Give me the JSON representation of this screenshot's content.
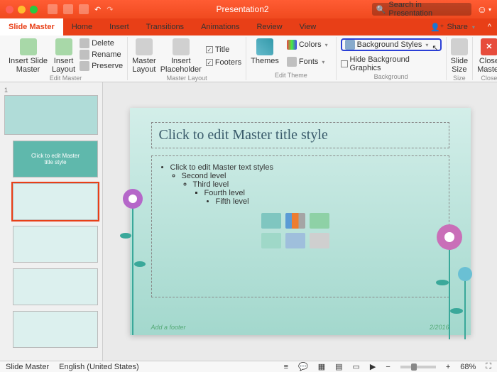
{
  "title": "Presentation2",
  "search_placeholder": "Search in Presentation",
  "share": "Share",
  "tabs": [
    "Slide Master",
    "Home",
    "Insert",
    "Transitions",
    "Animations",
    "Review",
    "View"
  ],
  "ribbon": {
    "insert_slide_master": "Insert Slide\nMaster",
    "insert_layout": "Insert\nLayout",
    "delete": "Delete",
    "rename": "Rename",
    "preserve": "Preserve",
    "edit_master": "Edit Master",
    "master_layout": "Master\nLayout",
    "insert_placeholder": "Insert\nPlaceholder",
    "title_chk": "Title",
    "footers_chk": "Footers",
    "master_layout_group": "Master Layout",
    "themes": "Themes",
    "colors": "Colors",
    "fonts": "Fonts",
    "edit_theme": "Edit Theme",
    "background_styles": "Background Styles",
    "hide_bg": "Hide Background Graphics",
    "background": "Background",
    "slide_size": "Slide\nSize",
    "size": "Size",
    "close_master": "Close\nMaster",
    "close": "Close"
  },
  "thumb_number": "1",
  "thumb_title_text": "Click to edit Master\ntitle style",
  "slide": {
    "title": "Click to edit Master title style",
    "l1": "Click to edit Master text styles",
    "l2": "Second level",
    "l3": "Third level",
    "l4": "Fourth level",
    "l5": "Fifth level",
    "footer": "Add a footer",
    "date": "2/2016"
  },
  "status": {
    "view": "Slide Master",
    "lang": "English (United States)",
    "zoom": "68%"
  }
}
